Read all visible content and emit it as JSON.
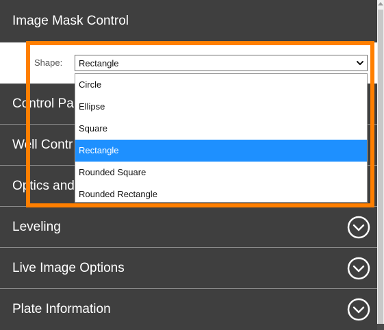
{
  "header": {
    "title": "Image Mask Control"
  },
  "shape": {
    "label": "Shape:",
    "selected": "Rectangle",
    "options": [
      "Circle",
      "Ellipse",
      "Square",
      "Rectangle",
      "Rounded Square",
      "Rounded Rectangle"
    ]
  },
  "sections": [
    {
      "label": "Control Pa"
    },
    {
      "label": "Well Contr"
    },
    {
      "label": "Optics and"
    },
    {
      "label": "Leveling"
    },
    {
      "label": "Live Image Options"
    },
    {
      "label": "Plate Information"
    }
  ],
  "colors": {
    "highlight": "#ff7f00",
    "selected_option": "#1e90ff",
    "panel": "#3f3f3f"
  },
  "icons": {
    "section_toggle": "chevron-down-circle-icon",
    "select_caret": "chevron-down-icon"
  }
}
